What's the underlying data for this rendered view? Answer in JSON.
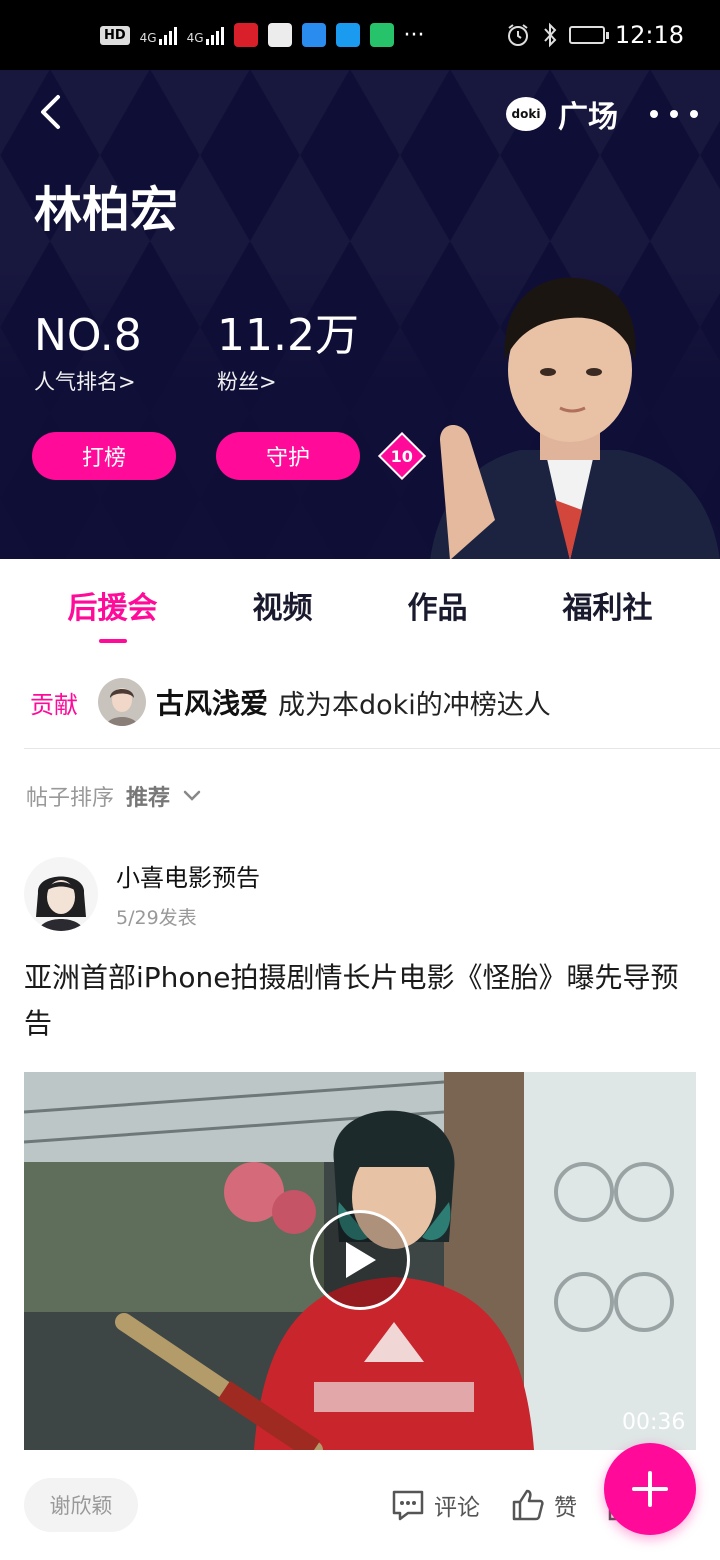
{
  "status_bar": {
    "hd_label": "HD",
    "net1": "4G",
    "net2": "4G",
    "time": "12:18",
    "more": "···"
  },
  "header": {
    "square_badge": "doki",
    "square_label": "广场"
  },
  "profile": {
    "name": "林柏宏",
    "rank_value": "NO.8",
    "rank_label": "人气排名>",
    "fans_value": "11.2万",
    "fans_label": "粉丝>",
    "btn_rank": "打榜",
    "btn_guard": "守护",
    "level": "10"
  },
  "tabs": [
    {
      "label": "后援会",
      "active": true
    },
    {
      "label": "视频",
      "active": false
    },
    {
      "label": "作品",
      "active": false
    },
    {
      "label": "福利社",
      "active": false
    }
  ],
  "contribution": {
    "label": "贡献",
    "user": "古风浅爱",
    "text": "成为本doki的冲榜达人"
  },
  "sort": {
    "label": "帖子排序",
    "value": "推荐"
  },
  "post": {
    "author": "小喜电影预告",
    "date": "5/29发表",
    "title": "亚洲首部iPhone拍摄剧情长片电影《怪胎》曝先导预告",
    "duration": "00:36",
    "tag": "谢欣颖",
    "comment_label": "评论",
    "like_label": "赞"
  },
  "colors": {
    "accent": "#ff0a99",
    "hero_bg": "#0f0e36",
    "tab_text": "#1a1a2e"
  },
  "icons": {
    "back": "chevron-left-icon",
    "more": "more-horizontal-icon",
    "sort": "chevron-down-icon",
    "play": "play-icon",
    "comment": "comment-icon",
    "like": "thumbs-up-icon",
    "share": "share-icon",
    "fab": "plus-icon"
  }
}
